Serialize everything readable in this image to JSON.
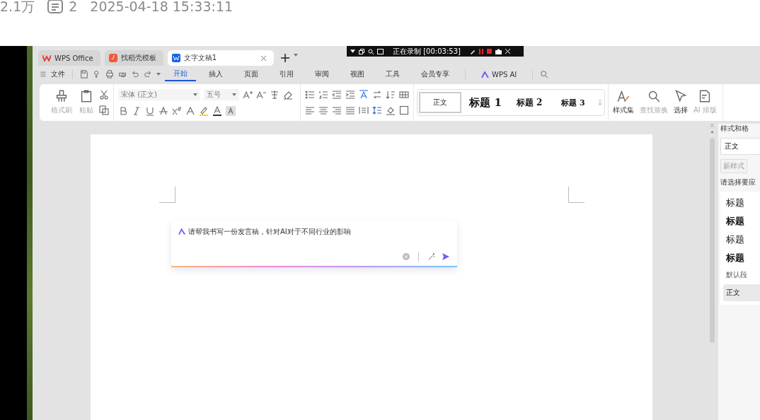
{
  "page_meta": {
    "views": "2.1万",
    "comments": "2",
    "datetime": "2025-04-18 15:33:11"
  },
  "recorder": {
    "status": "正在录制 [00:03:53]"
  },
  "tabs": [
    {
      "label": "WPS Office",
      "kind": "home",
      "selected": false
    },
    {
      "label": "找稻壳模板",
      "kind": "template",
      "selected": false
    },
    {
      "label": "文字文稿1",
      "kind": "doc",
      "selected": true
    }
  ],
  "menu": {
    "file": "文件",
    "items": [
      {
        "label": "开始",
        "selected": true
      },
      {
        "label": "插入",
        "selected": false
      },
      {
        "label": "页面",
        "selected": false
      },
      {
        "label": "引用",
        "selected": false
      },
      {
        "label": "审阅",
        "selected": false
      },
      {
        "label": "视图",
        "selected": false
      },
      {
        "label": "工具",
        "selected": false
      },
      {
        "label": "会员专享",
        "selected": false
      }
    ],
    "ai": "WPS AI"
  },
  "ribbon": {
    "clipboard": [
      {
        "label": "格式刷",
        "kind": "brush",
        "disabled": true
      },
      {
        "label": "粘贴",
        "kind": "paste",
        "disabled": true
      }
    ],
    "font": "宋体 (正文)",
    "size": "五号",
    "styles": [
      {
        "label": "正文",
        "selected": true
      },
      {
        "label": "标题 1",
        "selected": false
      },
      {
        "label": "标题 2",
        "selected": false
      },
      {
        "label": "标题 3",
        "selected": false
      }
    ],
    "tools": [
      {
        "label": "样式集",
        "kind": "styleset",
        "disabled": false
      },
      {
        "label": "查找替换",
        "kind": "find",
        "disabled": true
      },
      {
        "label": "选择",
        "kind": "select",
        "disabled": false
      },
      {
        "label": "AI 排版",
        "kind": "ailayout",
        "disabled": true
      }
    ]
  },
  "prompt": {
    "value": "请帮我书写一份发言稿，针对AI对于不同行业的影响"
  },
  "styles_panel": {
    "title": "样式和格",
    "current": "正文",
    "buttons": [
      "新样式"
    ],
    "hint": "请选择要应",
    "items": [
      {
        "label": "标题",
        "bold": false,
        "selected": false
      },
      {
        "label": "标题",
        "bold": true,
        "selected": false
      },
      {
        "label": "标题",
        "bold": false,
        "selected": false
      },
      {
        "label": "标题",
        "bold": true,
        "selected": false
      },
      {
        "label": "默认段",
        "bold": false,
        "selected": false
      },
      {
        "label": "正文",
        "bold": false,
        "selected": true
      }
    ]
  }
}
